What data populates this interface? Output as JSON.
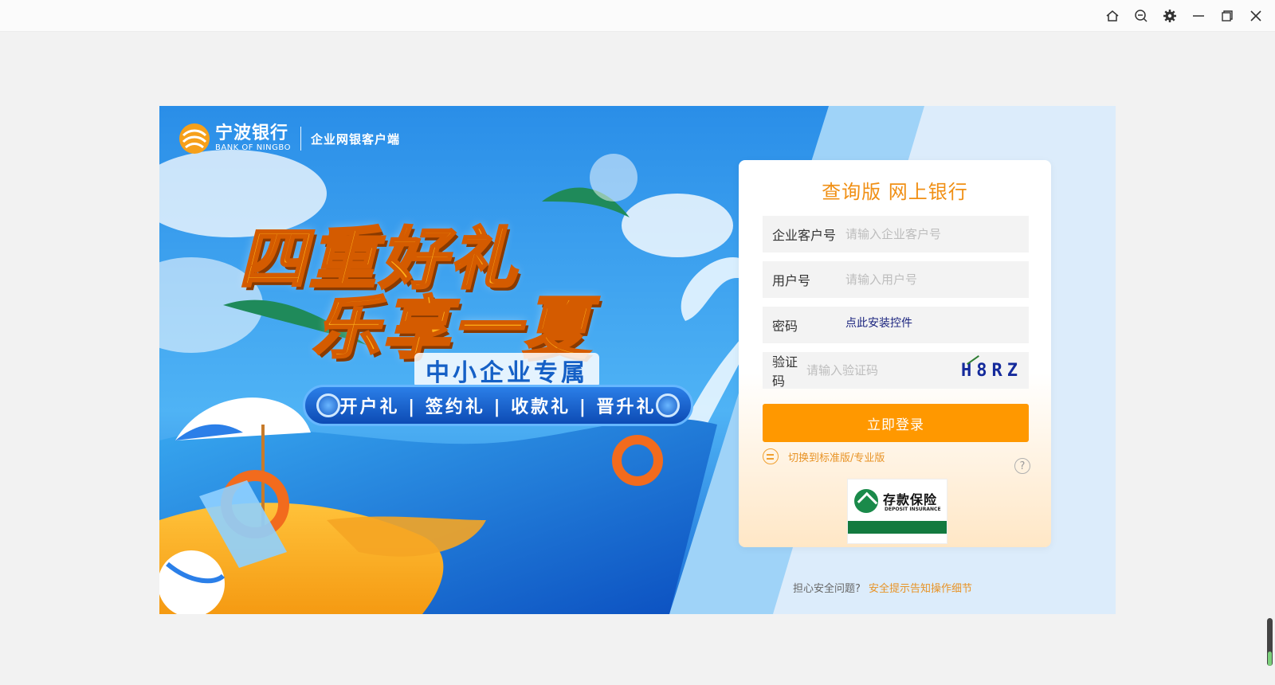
{
  "window": {
    "controls": [
      {
        "name": "home-icon"
      },
      {
        "name": "zoom-out-icon"
      },
      {
        "name": "gear-icon"
      },
      {
        "name": "minimize-icon"
      },
      {
        "name": "maximize-icon"
      },
      {
        "name": "close-icon"
      }
    ]
  },
  "brand": {
    "name_cn": "宁波银行",
    "name_en": "BANK OF NINGBO",
    "product": "企业网银客户端"
  },
  "promo": {
    "line1": "四重好礼",
    "line2": "乐享一夏",
    "subtitle": "中小企业专属",
    "gifts": "开户礼 | 签约礼 | 收款礼 | 晋升礼"
  },
  "login": {
    "title": "查询版 网上银行",
    "fields": {
      "customer_no": {
        "label": "企业客户号",
        "placeholder": "请输入企业客户号",
        "value": ""
      },
      "user_no": {
        "label": "用户号",
        "placeholder": "请输入用户号",
        "value": ""
      },
      "password": {
        "label": "密码",
        "install_link": "点此安装控件"
      },
      "captcha": {
        "label": "验证码",
        "placeholder": "请输入验证码",
        "value": "",
        "image_text": "H8RZ"
      }
    },
    "submit_label": "立即登录",
    "switch_label": "切换到标准版/专业版",
    "help_label": "?"
  },
  "deposit_insurance": {
    "cn": "存款保险",
    "en": "DEPOSIT INSURANCE"
  },
  "security": {
    "question": "担心安全问题?",
    "link": "安全提示告知操作细节"
  },
  "colors": {
    "accent": "#ff9800",
    "title_orange": "#f08f14",
    "link_orange": "#e89326",
    "banner_blue": "#1e88e5"
  }
}
